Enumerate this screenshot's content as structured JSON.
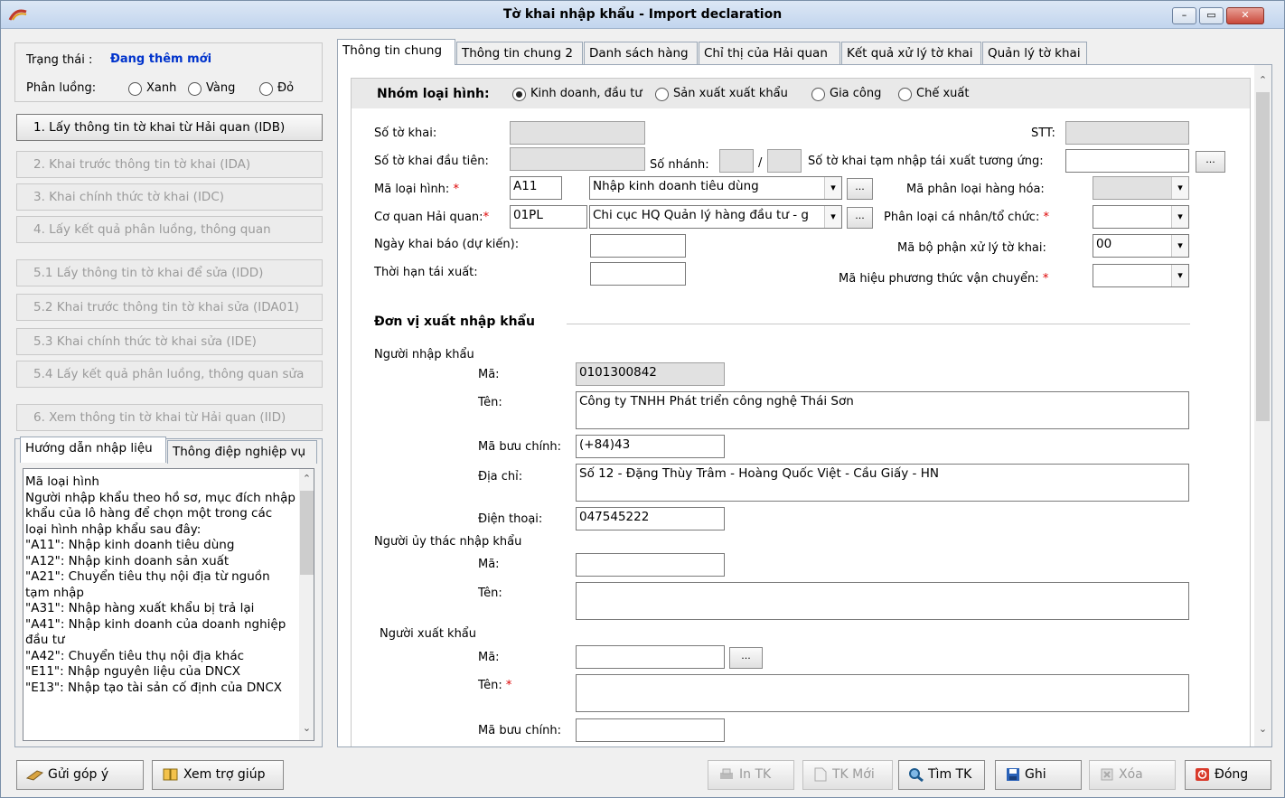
{
  "window": {
    "title": "Tờ khai nhập khẩu - Import declaration",
    "minimize": "–",
    "maximize": "▭",
    "close": "✕"
  },
  "status": {
    "label": "Trạng thái :",
    "value": "Đang thêm mới",
    "channel_label": "Phân luồng:",
    "channels": [
      "Xanh",
      "Vàng",
      "Đỏ"
    ]
  },
  "steps": [
    "1. Lấy thông tin tờ khai từ Hải quan (IDB)",
    "2. Khai trước thông tin tờ khai (IDA)",
    "3. Khai chính thức tờ khai (IDC)",
    "4. Lấy kết quả phân luồng, thông quan",
    "5.1 Lấy thông tin tờ khai để sửa (IDD)",
    "5.2 Khai trước thông tin tờ khai sửa (IDA01)",
    "5.3 Khai chính thức tờ khai sửa (IDE)",
    "5.4 Lấy kết quả phân luồng, thông quan sửa",
    "6. Xem thông tin tờ khai từ Hải quan (IID)"
  ],
  "help": {
    "tabs": [
      "Hướng dẫn nhập liệu",
      "Thông điệp nghiệp vụ"
    ],
    "text": "Mã loại hình\nNgười nhập khẩu theo hồ sơ, mục đích nhập khẩu của lô hàng để chọn một trong các loại hình nhập khẩu sau đây:\n\"A11\": Nhập kinh doanh tiêu dùng\n\"A12\": Nhập kinh doanh sản xuất\n\"A21\": Chuyển tiêu thụ nội địa từ nguồn tạm nhập\n\"A31\": Nhập hàng xuất khẩu bị trả lại\n\"A41\": Nhập kinh doanh của doanh nghiệp đầu tư\n\"A42\": Chuyển tiêu thụ nội địa khác\n\"E11\": Nhập nguyên liệu của DNCX\n\"E13\": Nhập tạo tài sản cố định của DNCX"
  },
  "tabs": [
    "Thông tin chung",
    "Thông tin chung 2",
    "Danh sách hàng",
    "Chỉ thị của Hải quan",
    "Kết quả xử lý tờ khai",
    "Quản lý tờ khai"
  ],
  "form": {
    "group_label": "Nhóm loại hình:",
    "group_options": [
      "Kinh doanh, đầu tư",
      "Sản xuất xuất khẩu",
      "Gia công",
      "Chế xuất"
    ],
    "so_to_khai": "Số tờ khai:",
    "stt": "STT:",
    "so_to_khai_dau_tien": "Số tờ khai đầu tiên:",
    "so_nhanh": "Số nhánh:",
    "slash": "/",
    "so_tk_tam_nhap": "Số tờ khai tạm nhập tái xuất tương ứng:",
    "ma_loai_hinh": "Mã loại hình:",
    "ma_loai_hinh_code": "A11",
    "ma_loai_hinh_name": "Nhập kinh doanh tiêu dùng",
    "ma_phan_loai": "Mã phân loại hàng hóa:",
    "co_quan": "Cơ quan Hải quan:",
    "co_quan_code": "01PL",
    "co_quan_name": "Chi cục HQ Quản lý hàng đầu tư - g",
    "phan_loai_cn": "Phân loại cá nhân/tổ chức:",
    "ngay_khai": "Ngày khai báo (dự kiến):",
    "ma_bo_phan": "Mã bộ phận xử lý tờ khai:",
    "ma_bo_phan_val": "00",
    "thoi_han": "Thời hạn tái xuất:",
    "ma_hieu_pt": "Mã hiệu phương thức vận chuyển:",
    "browse": "...",
    "star": "*",
    "section": "Đơn vị xuất nhập khẩu",
    "nnk": "Người nhập khẩu",
    "ma": "Mã:",
    "ten": "Tên:",
    "ma_buu_chinh": "Mã bưu chính:",
    "dia_chi": "Địa chỉ:",
    "dien_thoai": "Điện thoại:",
    "nnk_ma": "0101300842",
    "nnk_ten": "Công ty TNHH Phát triển công nghệ Thái Sơn",
    "nnk_buu_chinh": "(+84)43",
    "nnk_dia_chi": "Số 12 - Đặng Thùy Trâm - Hoàng Quốc Việt - Cầu Giấy - HN",
    "nnk_dien_thoai": "047545222",
    "nuy": "Người ủy thác nhập khẩu",
    "nxk": "Người xuất khẩu"
  },
  "bottom": {
    "feedback": "Gửi góp ý",
    "help": "Xem trợ giúp",
    "print": "In TK",
    "new": "TK Mới",
    "find": "Tìm TK",
    "save": "Ghi",
    "delete": "Xóa",
    "close": "Đóng"
  }
}
